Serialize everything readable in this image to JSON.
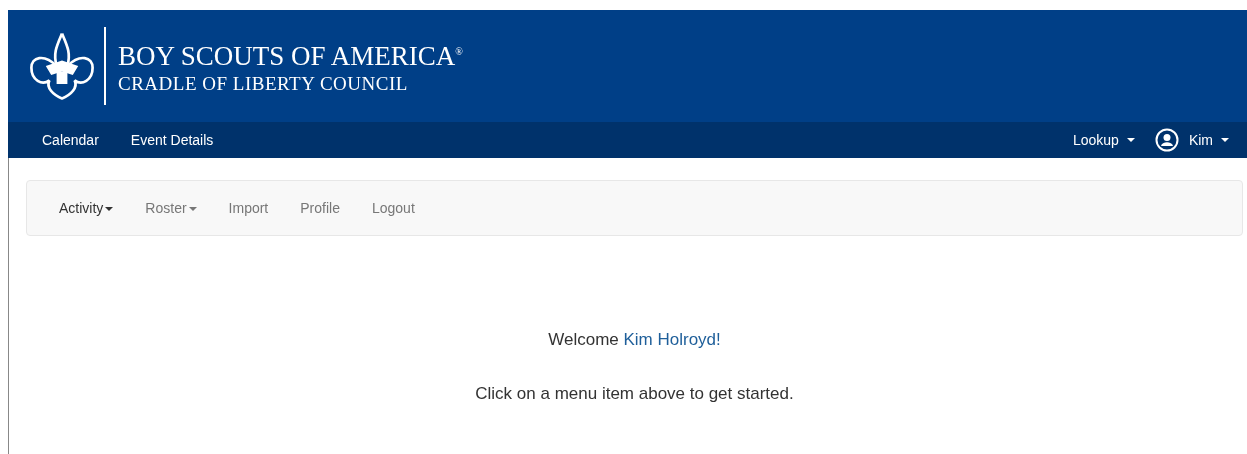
{
  "header": {
    "title": "BOY SCOUTS OF AMERICA$^{®}$",
    "subtitle": "CRADLE OF LIBERTY COUNCIL"
  },
  "navbar": {
    "left": [
      {
        "label": "Calendar"
      },
      {
        "label": "Event Details"
      }
    ],
    "right": [
      {
        "label": "Lookup",
        "kind": "dropdown"
      },
      {
        "label": "Kim",
        "kind": "user"
      }
    ]
  },
  "subnav": [
    {
      "label": "Activity",
      "dropdown": true,
      "selected": true
    },
    {
      "label": "Roster",
      "dropdown": true,
      "selected": false
    },
    {
      "label": "Import",
      "dropdown": false,
      "selected": false
    },
    {
      "label": "Profile",
      "dropdown": false,
      "selected": false
    },
    {
      "label": "Logout",
      "dropdown": false,
      "selected": false
    }
  ],
  "welcome": {
    "greeting": "Welcome",
    "name": "Kim Holroyd!",
    "instruction": "Click on a menu item above to get started."
  }
}
